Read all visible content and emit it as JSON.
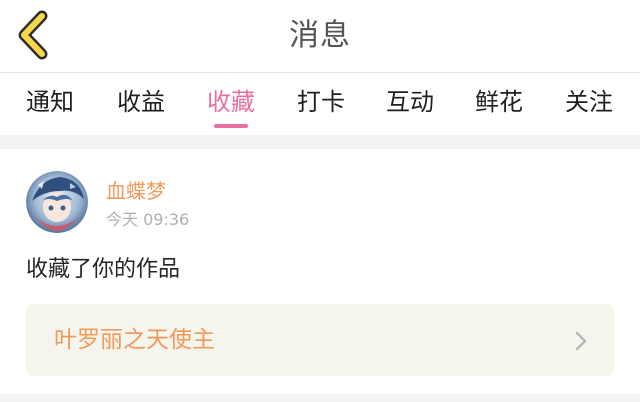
{
  "header": {
    "title": "消息",
    "back_icon": "chevron-left-icon"
  },
  "tabs": [
    {
      "label": "通知",
      "active": false
    },
    {
      "label": "收益",
      "active": false
    },
    {
      "label": "收藏",
      "active": true
    },
    {
      "label": "打卡",
      "active": false
    },
    {
      "label": "互动",
      "active": false
    },
    {
      "label": "鲜花",
      "active": false
    },
    {
      "label": "关注",
      "active": false
    }
  ],
  "message": {
    "username": "血蝶梦",
    "time": "今天 09:36",
    "action": "收藏了你的作品",
    "work_title": "叶罗丽之天使主"
  },
  "colors": {
    "accent_pink": "#e96fa3",
    "accent_orange": "#f09a5a",
    "back_icon_yellow": "#f6d84a"
  }
}
